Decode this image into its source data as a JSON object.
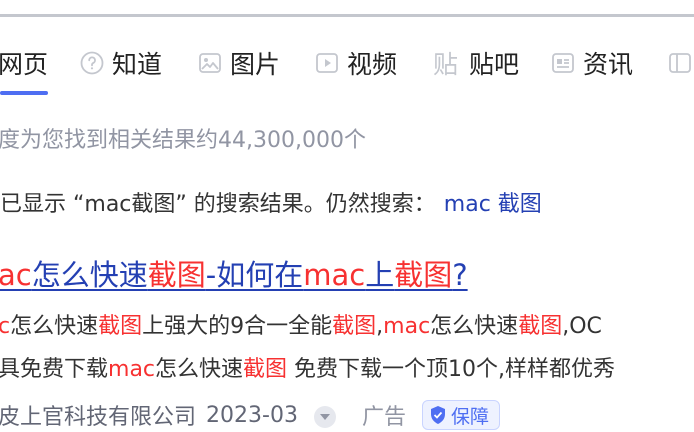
{
  "tabs": [
    {
      "label": "网页",
      "icon": "none",
      "active": true
    },
    {
      "label": "知道",
      "icon": "question-circle-icon"
    },
    {
      "label": "图片",
      "icon": "image-icon"
    },
    {
      "label": "视频",
      "icon": "play-icon"
    },
    {
      "label": "贴吧",
      "icon": "tieba-icon"
    },
    {
      "label": "资讯",
      "icon": "news-icon"
    }
  ],
  "result_count": "度为您找到相关结果约44,300,000个",
  "hint": {
    "text": "已显示 “mac截图” 的搜索结果。仍然搜索：",
    "link": "mac 截图"
  },
  "result": {
    "title": [
      {
        "t": "ac",
        "em": true
      },
      {
        "t": "怎么快速",
        "em": false
      },
      {
        "t": "截图",
        "em": true
      },
      {
        "t": "-如何在",
        "em": false
      },
      {
        "t": "mac",
        "em": true
      },
      {
        "t": "上",
        "em": false
      },
      {
        "t": "截图",
        "em": true
      },
      {
        "t": "?",
        "em": false
      }
    ],
    "snippet_line1": [
      {
        "t": "c",
        "em": true
      },
      {
        "t": "怎么快速",
        "em": false
      },
      {
        "t": "截图",
        "em": true
      },
      {
        "t": "上强大的9合一全能",
        "em": false
      },
      {
        "t": "截图",
        "em": true
      },
      {
        "t": ",",
        "em": false
      },
      {
        "t": "mac",
        "em": true
      },
      {
        "t": "怎么快速",
        "em": false
      },
      {
        "t": "截图",
        "em": true
      },
      {
        "t": ",OC",
        "em": false
      }
    ],
    "snippet_line2": [
      {
        "t": "具免费下载",
        "em": false
      },
      {
        "t": "mac",
        "em": true
      },
      {
        "t": "怎么快速",
        "em": false
      },
      {
        "t": "截图",
        "em": true
      },
      {
        "t": " 免费下载一个顶10个,样样都优秀",
        "em": false
      }
    ],
    "source": "皮上官科技有限公司",
    "date": "2023-03",
    "ad_label": "广告",
    "badge": "保障"
  },
  "colors": {
    "accent": "#4e6ef2",
    "link": "#2440b3",
    "highlight": "#f73131"
  }
}
